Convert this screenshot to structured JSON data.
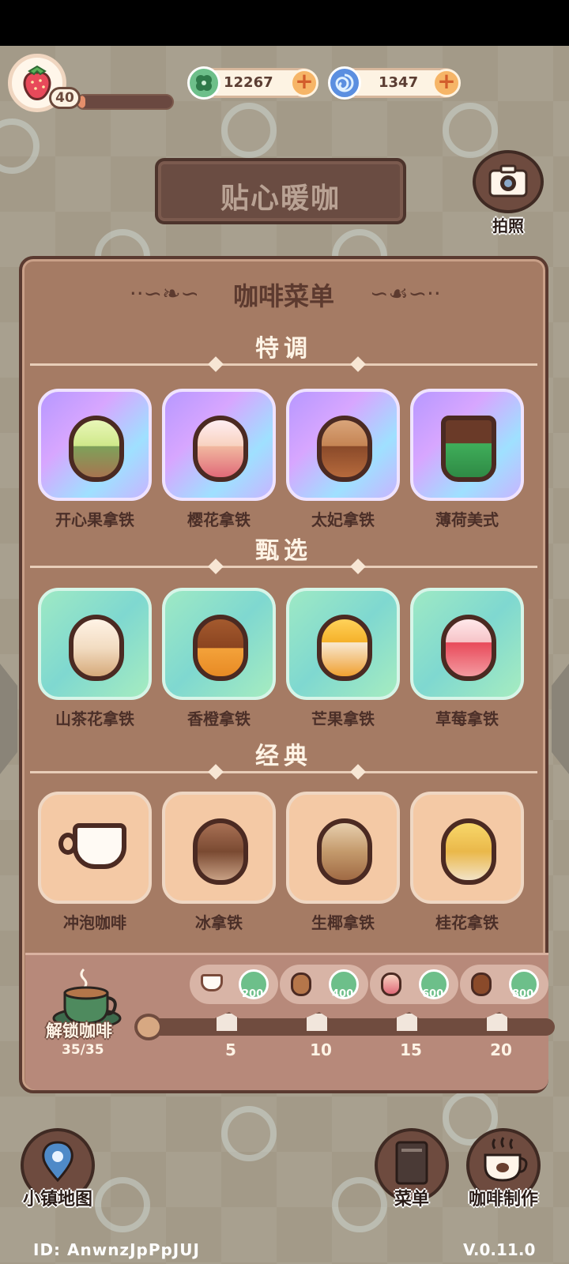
{
  "player": {
    "level": "40",
    "xp_fraction": 0.08
  },
  "currency": {
    "clover": "12267",
    "swirl": "1347"
  },
  "shop_name": "贴心暖咖",
  "camera_label": "拍照",
  "menu": {
    "title": "咖啡菜单",
    "sections": [
      {
        "title": "特调",
        "items": [
          "开心果拿铁",
          "樱花拿铁",
          "太妃拿铁",
          "薄荷美式"
        ]
      },
      {
        "title": "甄选",
        "items": [
          "山茶花拿铁",
          "香橙拿铁",
          "芒果拿铁",
          "草莓拿铁"
        ]
      },
      {
        "title": "经典",
        "items": [
          "冲泡咖啡",
          "冰拿铁",
          "生椰拿铁",
          "桂花拿铁"
        ]
      }
    ]
  },
  "unlock": {
    "label": "解锁咖啡",
    "count": "35/35",
    "rewards": [
      "200",
      "400",
      "600",
      "800"
    ],
    "milestones": [
      "5",
      "10",
      "15",
      "20"
    ]
  },
  "bottom_nav": {
    "map": "小镇地图",
    "menu": "菜单",
    "brew": "咖啡制作"
  },
  "footer": {
    "id": "ID:  AnwnzJpPpJUJ",
    "version": "V.0.11.0"
  },
  "colors": {
    "panel": "#a57b64",
    "panel_border": "#5a3a30",
    "special_card": "#c8a4ff",
    "select_card": "#8fe0c8",
    "classic_card": "#f4c9a5"
  }
}
